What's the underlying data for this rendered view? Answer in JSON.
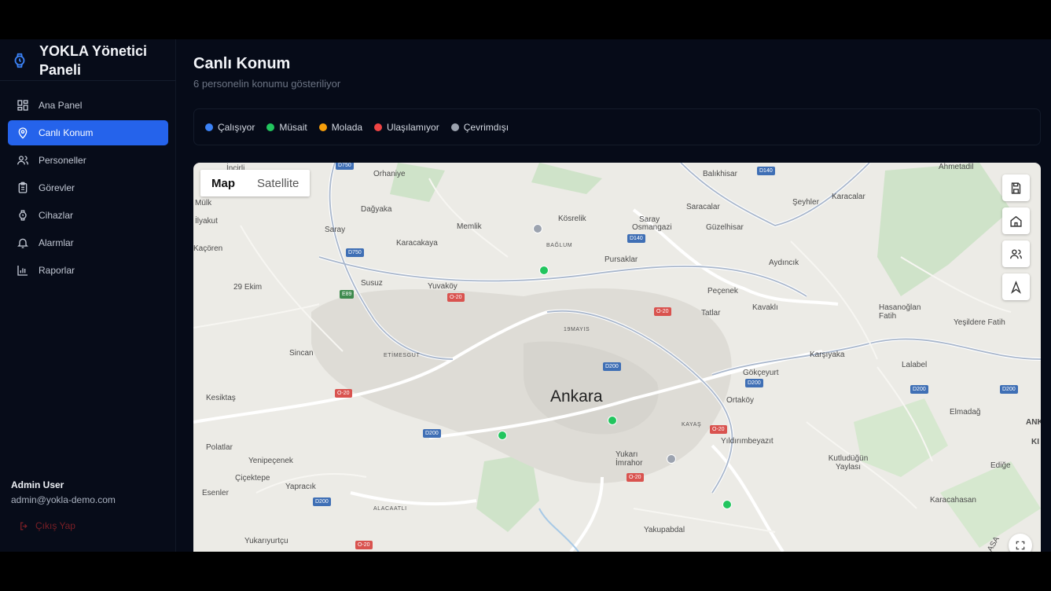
{
  "brand": {
    "title": "YOKLA Yönetici Paneli"
  },
  "sidebar": {
    "items": [
      {
        "label": "Ana Panel",
        "icon": "grid-icon",
        "active": false
      },
      {
        "label": "Canlı Konum",
        "icon": "location-pin-icon",
        "active": true
      },
      {
        "label": "Personeller",
        "icon": "users-icon",
        "active": false
      },
      {
        "label": "Görevler",
        "icon": "clipboard-icon",
        "active": false
      },
      {
        "label": "Cihazlar",
        "icon": "watch-icon",
        "active": false
      },
      {
        "label": "Alarmlar",
        "icon": "bell-icon",
        "active": false
      },
      {
        "label": "Raporlar",
        "icon": "bar-chart-icon",
        "active": false
      }
    ],
    "user": {
      "name": "Admin User",
      "email": "admin@yokla-demo.com"
    },
    "logout_label": "Çıkış Yap"
  },
  "page": {
    "title": "Canlı Konum",
    "subtitle": "6 personelin konumu gösteriliyor"
  },
  "legend": [
    {
      "label": "Çalışıyor",
      "color": "#3b82f6"
    },
    {
      "label": "Müsait",
      "color": "#22c55e"
    },
    {
      "label": "Molada",
      "color": "#f59e0b"
    },
    {
      "label": "Ulaşılamıyor",
      "color": "#ef4444"
    },
    {
      "label": "Çevrimdışı",
      "color": "#9ca3af"
    }
  ],
  "map": {
    "type_options": [
      "Map",
      "Satellite"
    ],
    "selected_type": "Map",
    "controls": [
      "save-icon",
      "home-icon",
      "users-icon",
      "navigation-arrow-icon"
    ],
    "city_label": "Ankara",
    "places": [
      "İncirli",
      "Orhaniye",
      "Balıkhisar",
      "Ahmetadil",
      "Mülk",
      "Dağyaka",
      "Kösrelik",
      "Saray",
      "Osmangazi",
      "Saracalar",
      "Şeyhler",
      "Karacalar",
      "İlyakut",
      "Saray",
      "Memlik",
      "Güzelhisar",
      "Karacakaya",
      "BAĞLUM",
      "Pursaklar",
      "Aydıncık",
      "Kaçören",
      "29 Ekim",
      "Susuz",
      "Yuvaköy",
      "Peçenek",
      "Tatlar",
      "Kavaklı",
      "Hasanoğlan Fatih",
      "Yeşildere Fatih",
      "19MAYIS",
      "Sincan",
      "ETİMESGUT",
      "Karşıyaka",
      "Lalabel",
      "Gökçeyurt",
      "Kesiktaş",
      "Ortaköy",
      "Elmadağ",
      "KAYAŞ",
      "Yıldırımbeyazıt",
      "Polatlar",
      "Yenipeçenek",
      "Yukarı İmrahor",
      "Kutludüğün Yaylası",
      "Ediğe",
      "Çiçektepe",
      "Yapracık",
      "Esenler",
      "Karacahasan",
      "ALACAATLI",
      "Yakupabdal",
      "Yukarıyurtçu",
      "ANK",
      "KI",
      "ASA"
    ],
    "road_badges": [
      {
        "label": "D750",
        "style": "blue"
      },
      {
        "label": "D140",
        "style": "blue"
      },
      {
        "label": "D140",
        "style": "blue"
      },
      {
        "label": "D750",
        "style": "blue"
      },
      {
        "label": "E89",
        "style": "green"
      },
      {
        "label": "O-20",
        "style": "red"
      },
      {
        "label": "O-20",
        "style": "red"
      },
      {
        "label": "D200",
        "style": "blue"
      },
      {
        "label": "D200",
        "style": "blue"
      },
      {
        "label": "D200",
        "style": "blue"
      },
      {
        "label": "D200",
        "style": "blue"
      },
      {
        "label": "O-20",
        "style": "red"
      },
      {
        "label": "D200",
        "style": "blue"
      },
      {
        "label": "O-20",
        "style": "red"
      },
      {
        "label": "O-20",
        "style": "red"
      },
      {
        "label": "D200",
        "style": "blue"
      },
      {
        "label": "O-20",
        "style": "red"
      }
    ],
    "markers": [
      {
        "status": "Çevrimdışı",
        "color": "#9ca3af"
      },
      {
        "status": "Müsait",
        "color": "#22c55e"
      },
      {
        "status": "Müsait",
        "color": "#22c55e"
      },
      {
        "status": "Müsait",
        "color": "#22c55e"
      },
      {
        "status": "Çevrimdışı",
        "color": "#9ca3af"
      },
      {
        "status": "Müsait",
        "color": "#22c55e"
      }
    ]
  }
}
